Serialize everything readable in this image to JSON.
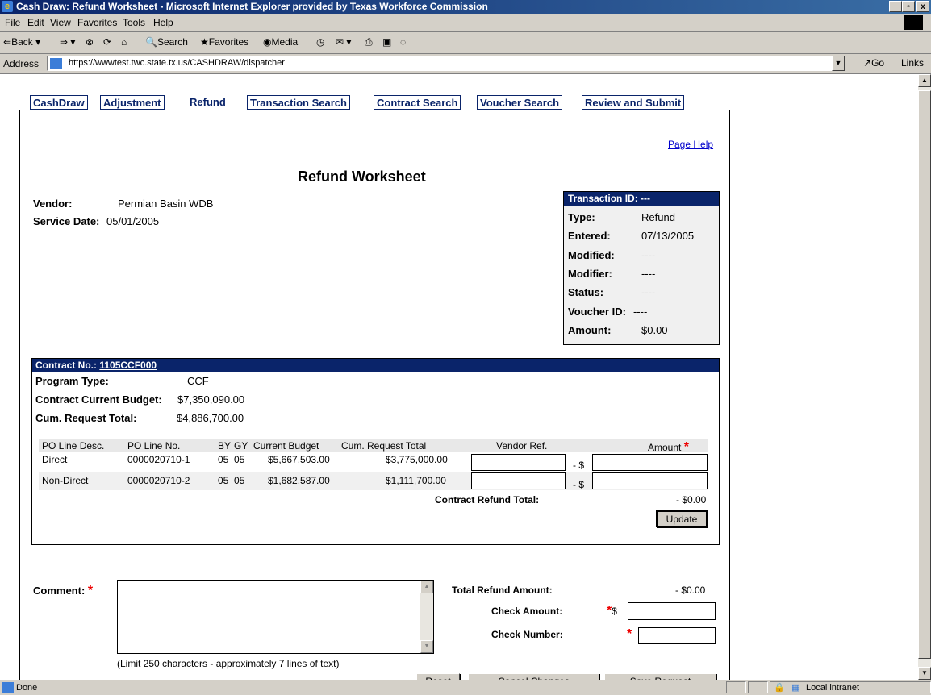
{
  "window": {
    "title": "Cash Draw: Refund Worksheet - Microsoft Internet Explorer provided by Texas Workforce Commission"
  },
  "menu": [
    "File",
    "Edit",
    "View",
    "Favorites",
    "Tools",
    "Help"
  ],
  "toolbar": {
    "back": "Back",
    "search": "Search",
    "favorites": "Favorites",
    "media": "Media"
  },
  "address": {
    "label": "Address",
    "url": "https://wwwtest.twc.state.tx.us/CASHDRAW/dispatcher",
    "go": "Go",
    "links": "Links"
  },
  "tabs": [
    "CashDraw",
    "Adjustment",
    "Refund",
    "Transaction Search",
    "Contract Search",
    "Voucher Search",
    "Review and Submit"
  ],
  "page": {
    "help_link": "Page Help",
    "title": "Refund Worksheet",
    "vendor_label": "Vendor:",
    "vendor_value": "Permian Basin WDB",
    "service_date_label": "Service Date:",
    "service_date_value": "05/01/2005"
  },
  "transaction": {
    "header": "Transaction ID: ---",
    "type_label": "Type:",
    "type_value": "Refund",
    "entered_label": "Entered:",
    "entered_value": "07/13/2005",
    "modified_label": "Modified:",
    "modified_value": "----",
    "modifier_label": "Modifier:",
    "modifier_value": "----",
    "status_label": "Status:",
    "status_value": "----",
    "voucher_label": "Voucher ID:",
    "voucher_value": "----",
    "amount_label": "Amount:",
    "amount_value": "$0.00"
  },
  "contract": {
    "header_label": "Contract No.:",
    "header_link": "1105CCF000",
    "program_type_label": "Program Type:",
    "program_type_value": "CCF",
    "budget_label": "Contract Current Budget:",
    "budget_value": "$7,350,090.00",
    "cum_label": "Cum. Request Total:",
    "cum_value": "$4,886,700.00",
    "columns": {
      "desc": "PO Line Desc.",
      "no": "PO Line No.",
      "by": "BY",
      "gy": "GY",
      "budget": "Current Budget",
      "cum": "Cum. Request Total",
      "vref": "Vendor Ref.",
      "amount": "Amount"
    },
    "rows": [
      {
        "desc": "Direct",
        "no": "0000020710-1",
        "by": "05",
        "gy": "05",
        "budget": "$5,667,503.00",
        "cum": "$3,775,000.00",
        "prefix": "- $"
      },
      {
        "desc": "Non-Direct",
        "no": "0000020710-2",
        "by": "05",
        "gy": "05",
        "budget": "$1,682,587.00",
        "cum": "$1,111,700.00",
        "prefix": "- $"
      }
    ],
    "refund_total_label": "Contract Refund Total:",
    "refund_total_value": "- $0.00",
    "update_button": "Update"
  },
  "comment": {
    "label": "Comment:",
    "limit_note": "(Limit 250 characters - approximately 7 lines of text)"
  },
  "totals": {
    "total_refund_label": "Total Refund Amount:",
    "total_refund_value": "- $0.00",
    "check_amount_label": "Check Amount:",
    "check_amount_prefix": "$",
    "check_number_label": "Check Number:"
  },
  "buttons": {
    "reset": "Reset",
    "cancel": "Cancel Changes",
    "save": "Save Request"
  },
  "status": {
    "text": "Done",
    "zone": "Local intranet"
  },
  "required_mark": "*"
}
